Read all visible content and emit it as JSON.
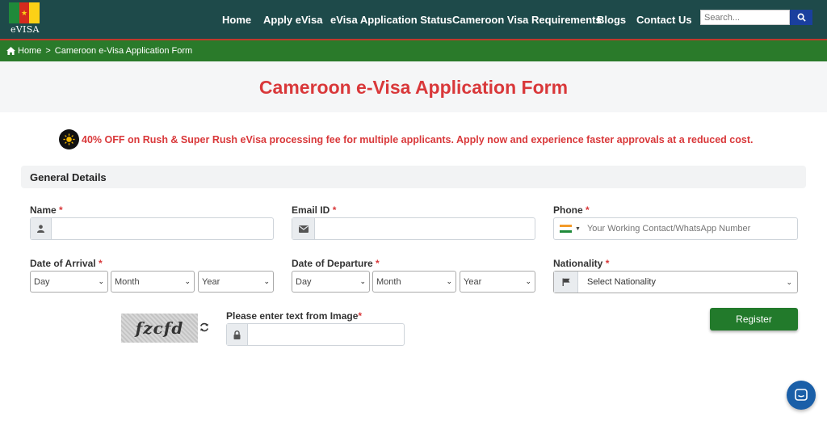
{
  "header": {
    "logo_text": "eVISA",
    "nav": [
      "Home",
      "Apply eVisa",
      "eVisa Application Status",
      "Cameroon Visa Requirements",
      "Blogs",
      "Contact Us"
    ],
    "search_placeholder": "Search..."
  },
  "breadcrumb": {
    "home": "Home",
    "separator": ">",
    "current": "Cameroon e-Visa Application Form"
  },
  "page_title": "Cameroon e-Visa Application Form",
  "offer": "40% OFF on Rush & Super Rush eVisa processing fee for multiple applicants. Apply now and experience faster approvals at a reduced cost.",
  "section_title": "General Details",
  "form": {
    "name_label": "Name",
    "email_label": "Email ID",
    "phone_label": "Phone",
    "phone_placeholder": "Your Working Contact/WhatsApp Number",
    "required_mark": "*",
    "arrival_label": "Date of Arrival",
    "departure_label": "Date of Departure",
    "nationality_label": "Nationality",
    "day": "Day",
    "month": "Month",
    "year": "Year",
    "nationality_placeholder": "Select Nationality",
    "captcha_image_text": "fzcfd",
    "captcha_label": "Please enter text from Image",
    "register": "Register"
  },
  "colors": {
    "header_bg": "#1e4a4a",
    "breadcrumb_bg": "#2a7a2a",
    "accent_red": "#d9383a",
    "button_green": "#227a2b"
  }
}
